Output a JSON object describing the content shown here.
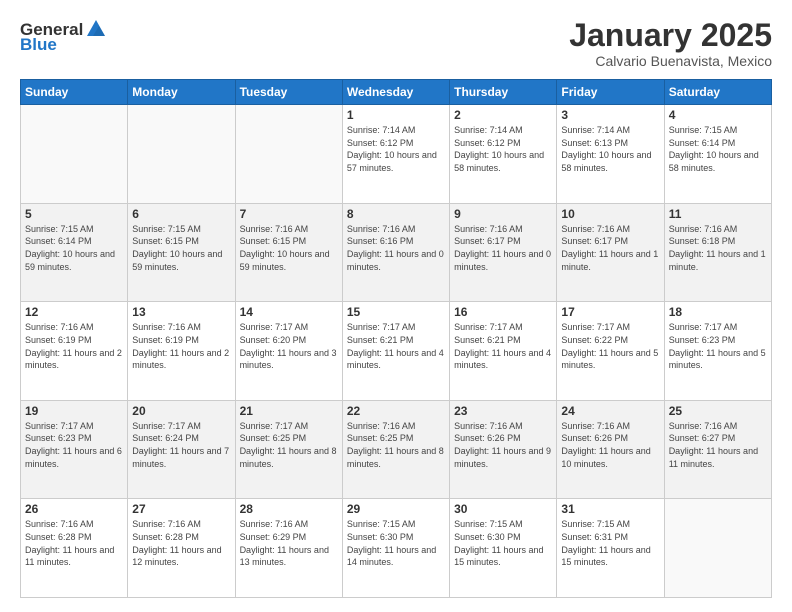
{
  "header": {
    "logo_general": "General",
    "logo_blue": "Blue",
    "title": "January 2025",
    "location": "Calvario Buenavista, Mexico"
  },
  "days_of_week": [
    "Sunday",
    "Monday",
    "Tuesday",
    "Wednesday",
    "Thursday",
    "Friday",
    "Saturday"
  ],
  "weeks": [
    [
      {
        "day": "",
        "info": ""
      },
      {
        "day": "",
        "info": ""
      },
      {
        "day": "",
        "info": ""
      },
      {
        "day": "1",
        "info": "Sunrise: 7:14 AM\nSunset: 6:12 PM\nDaylight: 10 hours and 57 minutes."
      },
      {
        "day": "2",
        "info": "Sunrise: 7:14 AM\nSunset: 6:12 PM\nDaylight: 10 hours and 58 minutes."
      },
      {
        "day": "3",
        "info": "Sunrise: 7:14 AM\nSunset: 6:13 PM\nDaylight: 10 hours and 58 minutes."
      },
      {
        "day": "4",
        "info": "Sunrise: 7:15 AM\nSunset: 6:14 PM\nDaylight: 10 hours and 58 minutes."
      }
    ],
    [
      {
        "day": "5",
        "info": "Sunrise: 7:15 AM\nSunset: 6:14 PM\nDaylight: 10 hours and 59 minutes."
      },
      {
        "day": "6",
        "info": "Sunrise: 7:15 AM\nSunset: 6:15 PM\nDaylight: 10 hours and 59 minutes."
      },
      {
        "day": "7",
        "info": "Sunrise: 7:16 AM\nSunset: 6:15 PM\nDaylight: 10 hours and 59 minutes."
      },
      {
        "day": "8",
        "info": "Sunrise: 7:16 AM\nSunset: 6:16 PM\nDaylight: 11 hours and 0 minutes."
      },
      {
        "day": "9",
        "info": "Sunrise: 7:16 AM\nSunset: 6:17 PM\nDaylight: 11 hours and 0 minutes."
      },
      {
        "day": "10",
        "info": "Sunrise: 7:16 AM\nSunset: 6:17 PM\nDaylight: 11 hours and 1 minute."
      },
      {
        "day": "11",
        "info": "Sunrise: 7:16 AM\nSunset: 6:18 PM\nDaylight: 11 hours and 1 minute."
      }
    ],
    [
      {
        "day": "12",
        "info": "Sunrise: 7:16 AM\nSunset: 6:19 PM\nDaylight: 11 hours and 2 minutes."
      },
      {
        "day": "13",
        "info": "Sunrise: 7:16 AM\nSunset: 6:19 PM\nDaylight: 11 hours and 2 minutes."
      },
      {
        "day": "14",
        "info": "Sunrise: 7:17 AM\nSunset: 6:20 PM\nDaylight: 11 hours and 3 minutes."
      },
      {
        "day": "15",
        "info": "Sunrise: 7:17 AM\nSunset: 6:21 PM\nDaylight: 11 hours and 4 minutes."
      },
      {
        "day": "16",
        "info": "Sunrise: 7:17 AM\nSunset: 6:21 PM\nDaylight: 11 hours and 4 minutes."
      },
      {
        "day": "17",
        "info": "Sunrise: 7:17 AM\nSunset: 6:22 PM\nDaylight: 11 hours and 5 minutes."
      },
      {
        "day": "18",
        "info": "Sunrise: 7:17 AM\nSunset: 6:23 PM\nDaylight: 11 hours and 5 minutes."
      }
    ],
    [
      {
        "day": "19",
        "info": "Sunrise: 7:17 AM\nSunset: 6:23 PM\nDaylight: 11 hours and 6 minutes."
      },
      {
        "day": "20",
        "info": "Sunrise: 7:17 AM\nSunset: 6:24 PM\nDaylight: 11 hours and 7 minutes."
      },
      {
        "day": "21",
        "info": "Sunrise: 7:17 AM\nSunset: 6:25 PM\nDaylight: 11 hours and 8 minutes."
      },
      {
        "day": "22",
        "info": "Sunrise: 7:16 AM\nSunset: 6:25 PM\nDaylight: 11 hours and 8 minutes."
      },
      {
        "day": "23",
        "info": "Sunrise: 7:16 AM\nSunset: 6:26 PM\nDaylight: 11 hours and 9 minutes."
      },
      {
        "day": "24",
        "info": "Sunrise: 7:16 AM\nSunset: 6:26 PM\nDaylight: 11 hours and 10 minutes."
      },
      {
        "day": "25",
        "info": "Sunrise: 7:16 AM\nSunset: 6:27 PM\nDaylight: 11 hours and 11 minutes."
      }
    ],
    [
      {
        "day": "26",
        "info": "Sunrise: 7:16 AM\nSunset: 6:28 PM\nDaylight: 11 hours and 11 minutes."
      },
      {
        "day": "27",
        "info": "Sunrise: 7:16 AM\nSunset: 6:28 PM\nDaylight: 11 hours and 12 minutes."
      },
      {
        "day": "28",
        "info": "Sunrise: 7:16 AM\nSunset: 6:29 PM\nDaylight: 11 hours and 13 minutes."
      },
      {
        "day": "29",
        "info": "Sunrise: 7:15 AM\nSunset: 6:30 PM\nDaylight: 11 hours and 14 minutes."
      },
      {
        "day": "30",
        "info": "Sunrise: 7:15 AM\nSunset: 6:30 PM\nDaylight: 11 hours and 15 minutes."
      },
      {
        "day": "31",
        "info": "Sunrise: 7:15 AM\nSunset: 6:31 PM\nDaylight: 11 hours and 15 minutes."
      },
      {
        "day": "",
        "info": ""
      }
    ]
  ]
}
